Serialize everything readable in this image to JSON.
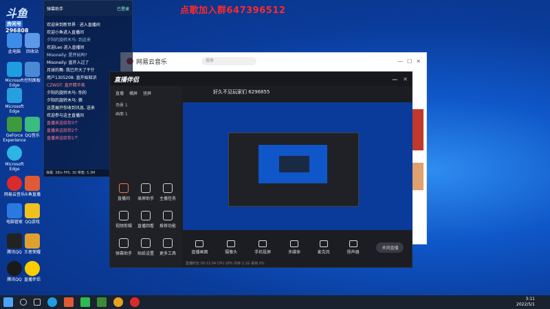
{
  "watermark": "点歌加入群647396512",
  "logo": {
    "title": "斗鱼",
    "room_label": "房间号",
    "room_id": "296808"
  },
  "desktop_icons": [
    {
      "label": "此电脑",
      "color": "#3d8de8"
    },
    {
      "label": "Microsoft Edge",
      "color": "#1f9de0"
    },
    {
      "label": "GeForce Experience",
      "color": "#3d9a3d"
    },
    {
      "label": "Microsoft Edge",
      "color": "#2fb4e6"
    },
    {
      "label": "网易云音乐",
      "color": "#d92b2b"
    },
    {
      "label": "电脑管家",
      "color": "#2a79e0"
    },
    {
      "label": "腾讯QQ",
      "color": "#111111"
    },
    {
      "label": "回收站",
      "color": "#5c9ae8"
    },
    {
      "label": "控制面板",
      "color": "#4a8ad4"
    },
    {
      "label": "QQ音乐",
      "color": "#3bbb7e"
    },
    {
      "label": "斗鱼直播",
      "color": "#e05a35"
    },
    {
      "label": "直播伴侣",
      "color": "#a0a0a0"
    },
    {
      "label": "QQ游戏",
      "color": "#f0c020"
    },
    {
      "label": "王者荣耀",
      "color": "#e0a030"
    }
  ],
  "chat": {
    "title": "弹幕助手",
    "status": "已登录",
    "lines": [
      "欢迎来到新世界 · 进入直播间",
      "欢迎小鱼进入直播间",
      "夕阳的旋转木马: 到这来",
      "欢迎Leo 进入直播间",
      "Misoneily: 是开玩吗?",
      "Misoneily: 直开入过了",
      "月球的舞: 我已开大了干什",
      "用户1305208: 直开始知识",
      "CZWDT: 直开精华美",
      "夕阳的旋转木马: 你的",
      "夕阳的旋转木马: 佛",
      "这是展开你收到讯息, 送来",
      "欢迎参与这主直播间",
      "直播来送给你3个",
      "直播来这给你2个",
      "直播来这给你1个"
    ],
    "footer": "弹幕: 38/s  FPS: 30  带宽: 5.3M"
  },
  "netease": {
    "title": "网易云音乐",
    "search_placeholder": "搜索"
  },
  "live": {
    "app_title": "直播伴侣",
    "room_title": "好久不见玩家们 6296855",
    "tabs": [
      "直播",
      "横屏",
      "竖屏"
    ],
    "sources": [
      "场景 1",
      "画面 1"
    ],
    "tools": [
      {
        "label": "直播间"
      },
      {
        "label": "录屏助手"
      },
      {
        "label": "主播任务"
      },
      {
        "label": "视频剪辑"
      },
      {
        "label": "直播回看"
      },
      {
        "label": "推荐功能"
      },
      {
        "label": "弹幕助手"
      },
      {
        "label": "贴纸设置"
      },
      {
        "label": "更多工具"
      }
    ],
    "bottom_tools": [
      {
        "label": "直播画面"
      },
      {
        "label": "摄像头"
      },
      {
        "label": "手机投屏"
      },
      {
        "label": "多媒体"
      },
      {
        "label": "麦克风"
      },
      {
        "label": "扬声器"
      }
    ],
    "go_live": "关闭直播",
    "status": "直播时长 00:12:34  CPU 18%  内存 2.1G  丢帧 0%"
  },
  "taskbar": {
    "time": "3:11",
    "date": "2022/5/1"
  }
}
